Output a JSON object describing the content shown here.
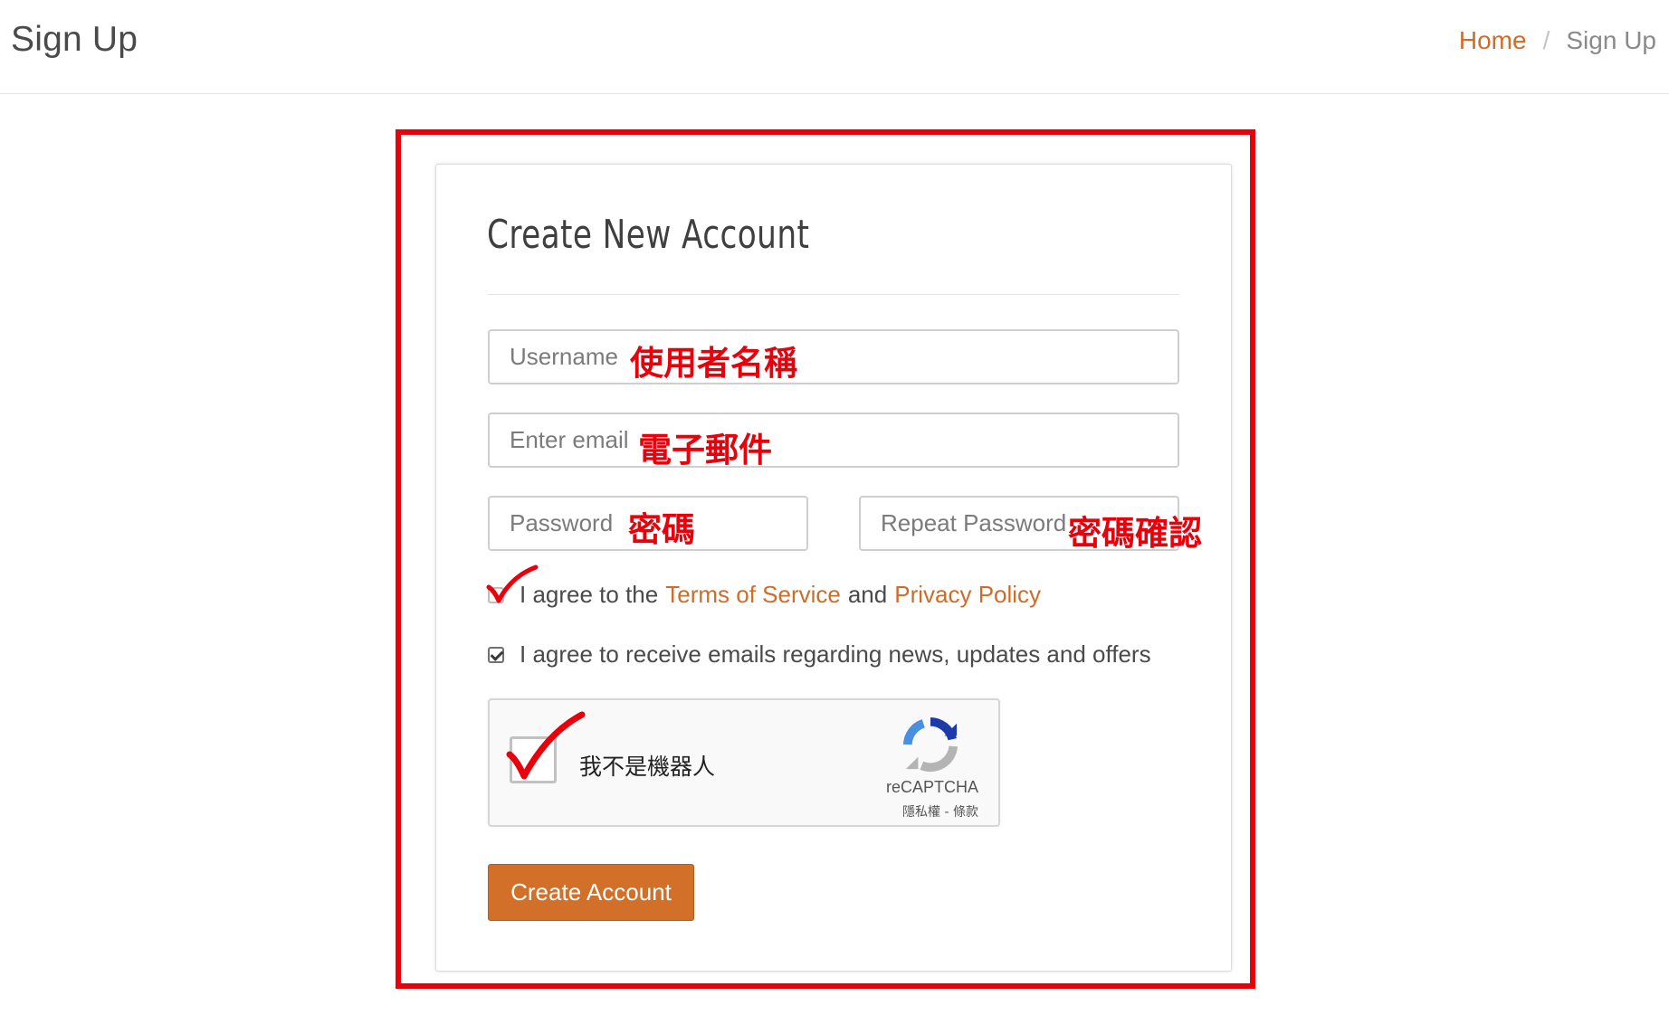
{
  "page": {
    "title": "Sign Up"
  },
  "breadcrumb": {
    "home": "Home",
    "separator": "/",
    "current": "Sign Up"
  },
  "form": {
    "heading": "Create New Account",
    "username": {
      "placeholder": "Username",
      "annotation": "使用者名稱"
    },
    "email": {
      "placeholder": "Enter email",
      "annotation": "電子郵件"
    },
    "password": {
      "placeholder": "Password",
      "annotation": "密碼"
    },
    "repeat_password": {
      "placeholder": "Repeat Password",
      "annotation": "密碼確認"
    },
    "terms_checkbox": {
      "checked": false,
      "prefix": "I agree to the",
      "terms_link": "Terms of Service",
      "middle": "and",
      "privacy_link": "Privacy Policy"
    },
    "news_checkbox": {
      "checked": true,
      "label": "I agree to receive emails regarding news, updates and offers"
    },
    "recaptcha": {
      "label": "我不是機器人",
      "brand": "reCAPTCHA",
      "links": "隱私權 - 條款"
    },
    "submit_label": "Create Account"
  },
  "colors": {
    "accent": "#cf6c28",
    "button": "#d26f29",
    "annotation_red": "#e8000b"
  },
  "icons": {
    "recaptcha_logo": "recaptcha-logo-icon",
    "annotation_check": "red-check-mark-icon"
  }
}
